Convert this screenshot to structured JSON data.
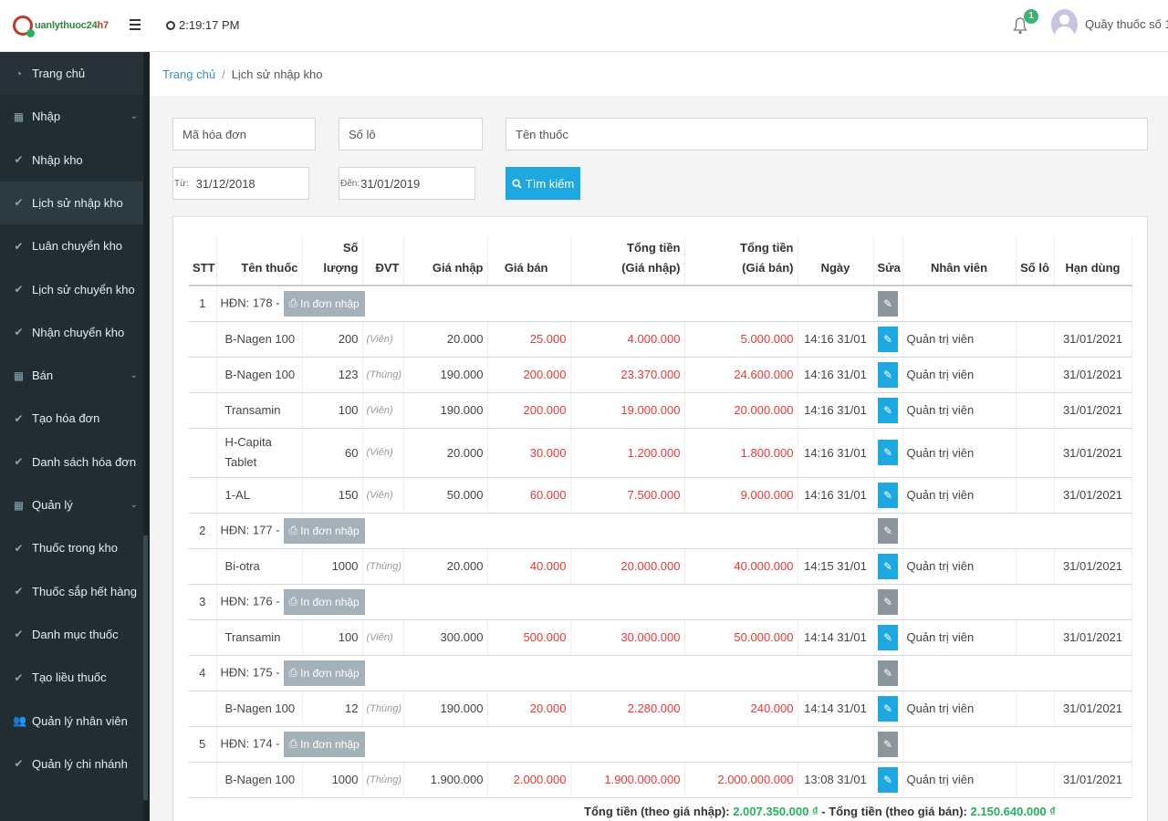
{
  "app": {
    "logo_text": "uanlythuoc24",
    "logo_suffix": "h7",
    "clock": "2:19:17 PM",
    "notifications": "1",
    "user": "Quầy thuốc số 1 ▾"
  },
  "breadcrumb": {
    "home": "Trang chủ",
    "current": "Lịch sử nhập kho"
  },
  "sidebar": [
    {
      "label": "Trang chủ",
      "icon": "dashboard-icon",
      "glyph": "◔",
      "chev": ""
    },
    {
      "label": "Nhập",
      "icon": "calendar-icon",
      "glyph": "▦",
      "chev": "⌄"
    },
    {
      "label": "Nhập kho",
      "icon": "check-icon",
      "glyph": "✔",
      "chev": ""
    },
    {
      "label": "Lịch sử nhập kho",
      "icon": "check-icon",
      "glyph": "✔",
      "chev": ""
    },
    {
      "label": "Luân chuyển kho",
      "icon": "check-icon",
      "glyph": "✔",
      "chev": ""
    },
    {
      "label": "Lịch sử chuyển kho",
      "icon": "check-icon",
      "glyph": "✔",
      "chev": ""
    },
    {
      "label": "Nhận chuyển kho",
      "icon": "check-icon",
      "glyph": "✔",
      "chev": ""
    },
    {
      "label": "Bán",
      "icon": "calendar-icon",
      "glyph": "▦",
      "chev": "⌄"
    },
    {
      "label": "Tạo hóa đơn",
      "icon": "check-icon",
      "glyph": "✔",
      "chev": ""
    },
    {
      "label": "Danh sách hóa đơn",
      "icon": "check-icon",
      "glyph": "✔",
      "chev": ""
    },
    {
      "label": "Quản lý",
      "icon": "calendar-icon",
      "glyph": "▦",
      "chev": "⌄"
    },
    {
      "label": "Thuốc trong kho",
      "icon": "check-icon",
      "glyph": "✔",
      "chev": ""
    },
    {
      "label": "Thuốc sắp hết hàng",
      "icon": "check-icon",
      "glyph": "✔",
      "chev": ""
    },
    {
      "label": "Danh mục thuốc",
      "icon": "check-icon",
      "glyph": "✔",
      "chev": ""
    },
    {
      "label": "Tạo liều thuốc",
      "icon": "check-icon",
      "glyph": "✔",
      "chev": ""
    },
    {
      "label": "Quản lý nhân viên",
      "icon": "users-icon",
      "glyph": "👥",
      "chev": ""
    },
    {
      "label": "Quản lý chi nhánh",
      "icon": "check-icon",
      "glyph": "✔",
      "chev": ""
    }
  ],
  "filters": {
    "invoice_placeholder": "Mã hóa đơn",
    "lot_placeholder": "Số lô",
    "drug_placeholder": "Tên thuốc",
    "from_label": "Từ:",
    "from_value": "31/12/2018",
    "to_label": "Đến:",
    "to_value": "31/01/2019",
    "search_label": "Tìm kiếm"
  },
  "table": {
    "headers": {
      "stt": "STT",
      "name": "Tên thuốc",
      "qty": "Số lượng",
      "unit": "ĐVT",
      "buy": "Giá nhập",
      "sell": "Giá bán",
      "total_buy_1": "Tổng tiền",
      "total_buy_2": "(Giá nhập)",
      "total_sell_1": "Tổng tiền",
      "total_sell_2": "(Giá bán)",
      "date": "Ngày",
      "edit": "Sửa",
      "staff": "Nhân viên",
      "lot": "Số lô",
      "expiry": "Hạn dùng"
    },
    "print_label": "In đơn nhập",
    "groups": [
      {
        "stt": "1",
        "invoice": "HĐN: 178 -",
        "rows": [
          {
            "name": "B-Nagen 100",
            "qty": "200",
            "unit": "(Viên)",
            "buy": "20.000",
            "sell": "25.000",
            "tbuy": "4.000.000",
            "tsell": "5.000.000",
            "date": "14:16 31/01",
            "staff": "Quản trị viên",
            "lot": "",
            "expiry": "31/01/2021"
          },
          {
            "name": "B-Nagen 100",
            "qty": "123",
            "unit": "(Thùng)",
            "buy": "190.000",
            "sell": "200.000",
            "tbuy": "23.370.000",
            "tsell": "24.600.000",
            "date": "14:16 31/01",
            "staff": "Quản trị viên",
            "lot": "",
            "expiry": "31/01/2021"
          },
          {
            "name": "Transamin",
            "qty": "100",
            "unit": "(Viên)",
            "buy": "190.000",
            "sell": "200.000",
            "tbuy": "19.000.000",
            "tsell": "20.000.000",
            "date": "14:16 31/01",
            "staff": "Quản trị viên",
            "lot": "",
            "expiry": "31/01/2021"
          },
          {
            "name": "H-Capita Tablet",
            "qty": "60",
            "unit": "(Viên)",
            "buy": "20.000",
            "sell": "30.000",
            "tbuy": "1.200.000",
            "tsell": "1.800.000",
            "date": "14:16 31/01",
            "staff": "Quản trị viên",
            "lot": "",
            "expiry": "31/01/2021"
          },
          {
            "name": "1-AL",
            "qty": "150",
            "unit": "(Viên)",
            "buy": "50.000",
            "sell": "60.000",
            "tbuy": "7.500.000",
            "tsell": "9.000.000",
            "date": "14:16 31/01",
            "staff": "Quản trị viên",
            "lot": "",
            "expiry": "31/01/2021"
          }
        ]
      },
      {
        "stt": "2",
        "invoice": "HĐN: 177 -",
        "rows": [
          {
            "name": "Bi-otra",
            "qty": "1000",
            "unit": "(Thùng)",
            "buy": "20.000",
            "sell": "40.000",
            "tbuy": "20.000.000",
            "tsell": "40.000.000",
            "date": "14:15 31/01",
            "staff": "Quản trị viên",
            "lot": "",
            "expiry": "31/01/2021"
          }
        ]
      },
      {
        "stt": "3",
        "invoice": "HĐN: 176 -",
        "rows": [
          {
            "name": "Transamin",
            "qty": "100",
            "unit": "(Viên)",
            "buy": "300.000",
            "sell": "500.000",
            "tbuy": "30.000.000",
            "tsell": "50.000.000",
            "date": "14:14 31/01",
            "staff": "Quản trị viên",
            "lot": "",
            "expiry": "31/01/2021"
          }
        ]
      },
      {
        "stt": "4",
        "invoice": "HĐN: 175 -",
        "rows": [
          {
            "name": "B-Nagen 100",
            "qty": "12",
            "unit": "(Thùng)",
            "buy": "190.000",
            "sell": "20.000",
            "tbuy": "2.280.000",
            "tsell": "240.000",
            "date": "14:14 31/01",
            "staff": "Quản trị viên",
            "lot": "",
            "expiry": "31/01/2021"
          }
        ]
      },
      {
        "stt": "5",
        "invoice": "HĐN: 174 -",
        "rows": [
          {
            "name": "B-Nagen 100",
            "qty": "1000",
            "unit": "(Thùng)",
            "buy": "1.900.000",
            "sell": "2.000.000",
            "tbuy": "1.900.000.000",
            "tsell": "2.000.000.000",
            "date": "13:08 31/01",
            "staff": "Quản trị viên",
            "lot": "",
            "expiry": "31/01/2021"
          }
        ]
      }
    ]
  },
  "totals": {
    "label_buy": "Tổng tiền (theo giá nhập):",
    "value_buy": "2.007.350.000 ₫",
    "sep": "-",
    "label_sell": "Tổng tiền (theo giá bán):",
    "value_sell": "2.150.640.000 ₫"
  }
}
